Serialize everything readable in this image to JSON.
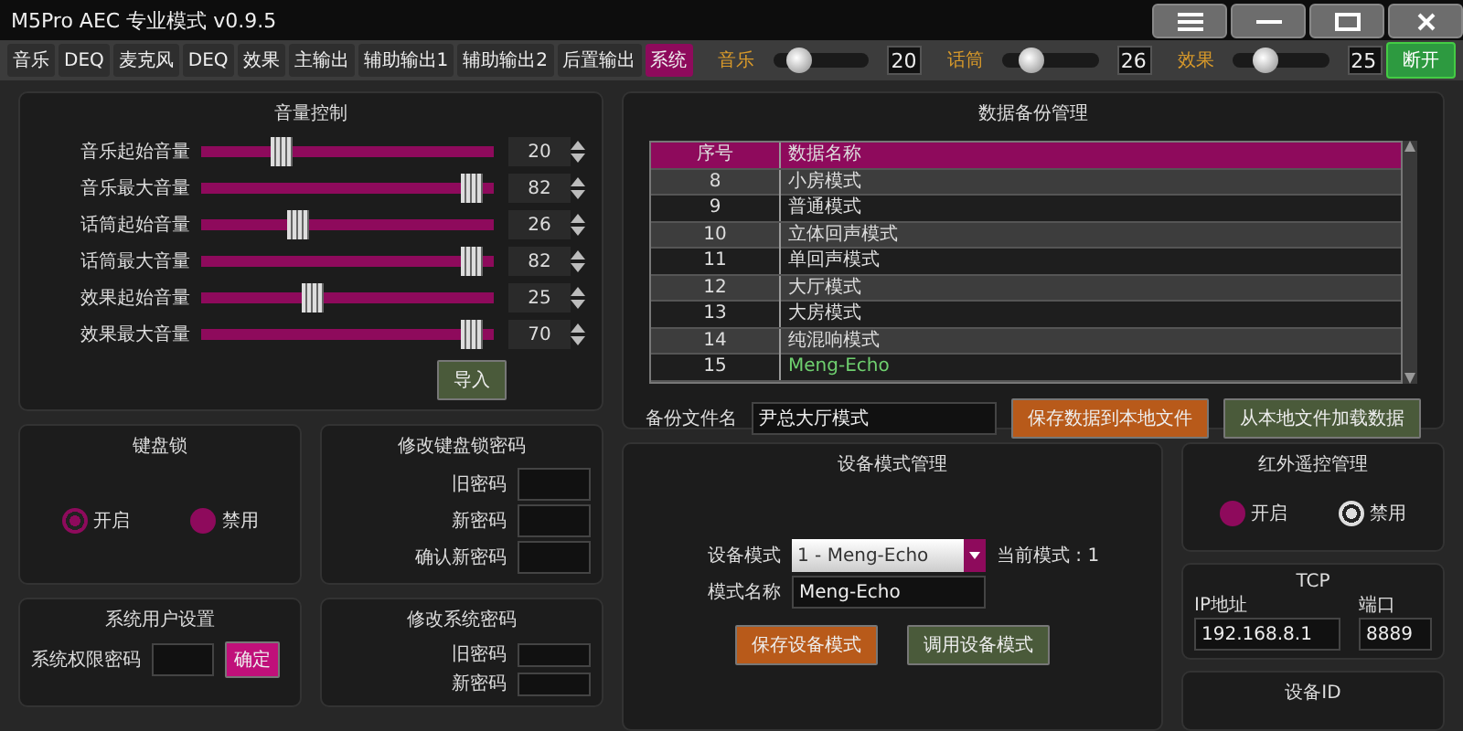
{
  "window": {
    "title": "M5Pro AEC 专业模式 v0.9.5"
  },
  "tabs": [
    {
      "label": "音乐",
      "selected": false
    },
    {
      "label": "DEQ",
      "selected": false
    },
    {
      "label": "麦克风",
      "selected": false
    },
    {
      "label": "DEQ",
      "selected": false
    },
    {
      "label": "效果",
      "selected": false
    },
    {
      "label": "主输出",
      "selected": false
    },
    {
      "label": "辅助输出1",
      "selected": false
    },
    {
      "label": "辅助输出2",
      "selected": false
    },
    {
      "label": "后置输出",
      "selected": false
    },
    {
      "label": "系统",
      "selected": true
    }
  ],
  "quick_levels": [
    {
      "label": "音乐",
      "level": 0.27,
      "value": "20"
    },
    {
      "label": "话筒",
      "level": 0.3,
      "value": "26"
    },
    {
      "label": "效果",
      "level": 0.35,
      "value": "25"
    }
  ],
  "connect_button": "断开",
  "volume_control": {
    "title": "音量控制",
    "rows": [
      {
        "label": "音乐起始音量",
        "level": 0.26,
        "value": "20"
      },
      {
        "label": "音乐最大音量",
        "level": 0.96,
        "value": "82"
      },
      {
        "label": "话筒起始音量",
        "level": 0.32,
        "value": "26"
      },
      {
        "label": "话筒最大音量",
        "level": 0.96,
        "value": "82"
      },
      {
        "label": "效果起始音量",
        "level": 0.37,
        "value": "25"
      },
      {
        "label": "效果最大音量",
        "level": 0.96,
        "value": "70"
      }
    ],
    "import_button": "导入"
  },
  "keyboard_lock": {
    "title": "键盘锁",
    "options": [
      {
        "label": "开启",
        "selected": true
      },
      {
        "label": "禁用",
        "selected": false
      }
    ]
  },
  "keyboard_password": {
    "title": "修改键盘锁密码",
    "fields": [
      "旧密码",
      "新密码",
      "确认新密码"
    ]
  },
  "system_user": {
    "title": "系统用户设置",
    "field_label": "系统权限密码",
    "button": "确定"
  },
  "system_password": {
    "title": "修改系统密码",
    "fields": [
      "旧密码",
      "新密码"
    ]
  },
  "backup": {
    "title": "数据备份管理",
    "columns": [
      "序号",
      "数据名称"
    ],
    "rows": [
      {
        "index": "8",
        "name": "小房模式",
        "highlighted": false
      },
      {
        "index": "9",
        "name": "普通模式",
        "highlighted": false
      },
      {
        "index": "10",
        "name": "立体回声模式",
        "highlighted": false
      },
      {
        "index": "11",
        "name": "单回声模式",
        "highlighted": false
      },
      {
        "index": "12",
        "name": "大厅模式",
        "highlighted": false
      },
      {
        "index": "13",
        "name": "大房模式",
        "highlighted": false
      },
      {
        "index": "14",
        "name": "纯混响模式",
        "highlighted": false
      },
      {
        "index": "15",
        "name": "Meng-Echo",
        "highlighted": true
      }
    ],
    "file_label": "备份文件名",
    "file_value": "尹总大厅模式",
    "save_button": "保存数据到本地文件",
    "load_button": "从本地文件加载数据"
  },
  "device_mode": {
    "title": "设备模式管理",
    "mode_label": "设备模式",
    "mode_value": "1 - Meng-Echo",
    "current": "当前模式 : 1",
    "name_label": "模式名称",
    "name_value": "Meng-Echo",
    "save_button": "保存设备模式",
    "load_button": "调用设备模式"
  },
  "ir_remote": {
    "title": "红外遥控管理",
    "options": [
      {
        "label": "开启",
        "selected": false
      },
      {
        "label": "禁用",
        "selected": true
      }
    ]
  },
  "tcp": {
    "title": "TCP",
    "ip_label": "IP地址",
    "ip_value": "192.168.8.1",
    "port_label": "端口",
    "port_value": "8889"
  },
  "device_id": {
    "title": "设备ID"
  }
}
